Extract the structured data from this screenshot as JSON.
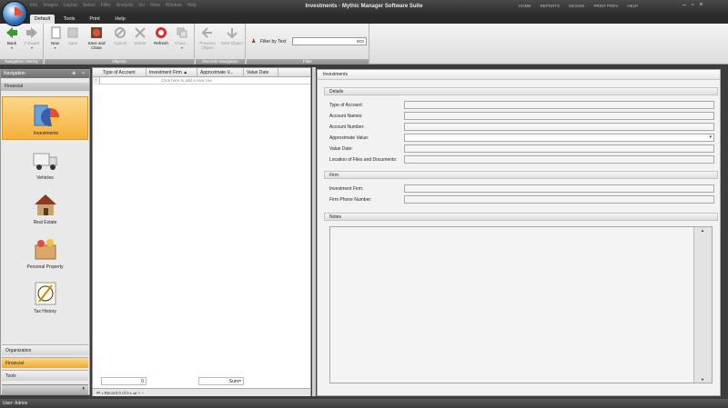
{
  "window": {
    "title": "Investments - Mythic Manager Software Suite",
    "quick_access": [
      "Info",
      "Images",
      "Layout",
      "Select",
      "Filter",
      "Analysis",
      "Go",
      "View",
      "Window",
      "Help"
    ],
    "title_menus": [
      "HOME",
      "REPORTS",
      "DESIGN",
      "PRINT PREV",
      "HELP"
    ]
  },
  "ribbon": {
    "tabs": [
      "Default",
      "Tools",
      "Print",
      "Help"
    ],
    "groups": {
      "navigation_history": "Navigation History",
      "objects": "Objects",
      "records_navigation": "Records Navigation",
      "filter": "Filter"
    },
    "buttons": {
      "back": "Back",
      "forward": "Forward",
      "new": "New",
      "save": "Save",
      "save_close": "Save and Close",
      "cancel": "Cancel",
      "delete": "Delete",
      "refresh": "Refresh",
      "clone": "Clone...",
      "previous_object": "Previous Object",
      "next_object": "Next Object",
      "filter_by_text": "Filter by Text",
      "go": "GO!"
    },
    "colors": {
      "refresh": "#d9302a",
      "back": "#3a9a2e"
    }
  },
  "navigation": {
    "header": "Navigation",
    "pin_icon": "pin-icon",
    "close_icon": "close-icon",
    "category": "Financial",
    "items": [
      "Investments",
      "Vehicles",
      "Real Estate",
      "Personal Property",
      "Tax History"
    ],
    "selected": "Investments",
    "bottom_bars": [
      "Organization",
      "Financial",
      "Tools"
    ]
  },
  "grid": {
    "columns": [
      "Type of Account",
      "Investment Firm",
      "Approximate V...",
      "Value Date"
    ],
    "sort_column": "Investment Firm",
    "new_row_prompt": "Click here to add a new row",
    "count_value": "0",
    "sum_label": "Sum=",
    "pager_text": "Record 0 of 0"
  },
  "detail": {
    "title": "Investments",
    "sections": {
      "details": "Details",
      "firm": "Firm",
      "notes": "Notes"
    },
    "detail_fields": [
      "Type of Account:",
      "Account Names:",
      "Account Number:",
      "Approximate Value:",
      "Value Date:",
      "Location of Files and Documents:"
    ],
    "firm_fields": [
      "Investment Firm:",
      "Firm Phone Number:"
    ]
  },
  "status": {
    "user": "User: Admin"
  }
}
